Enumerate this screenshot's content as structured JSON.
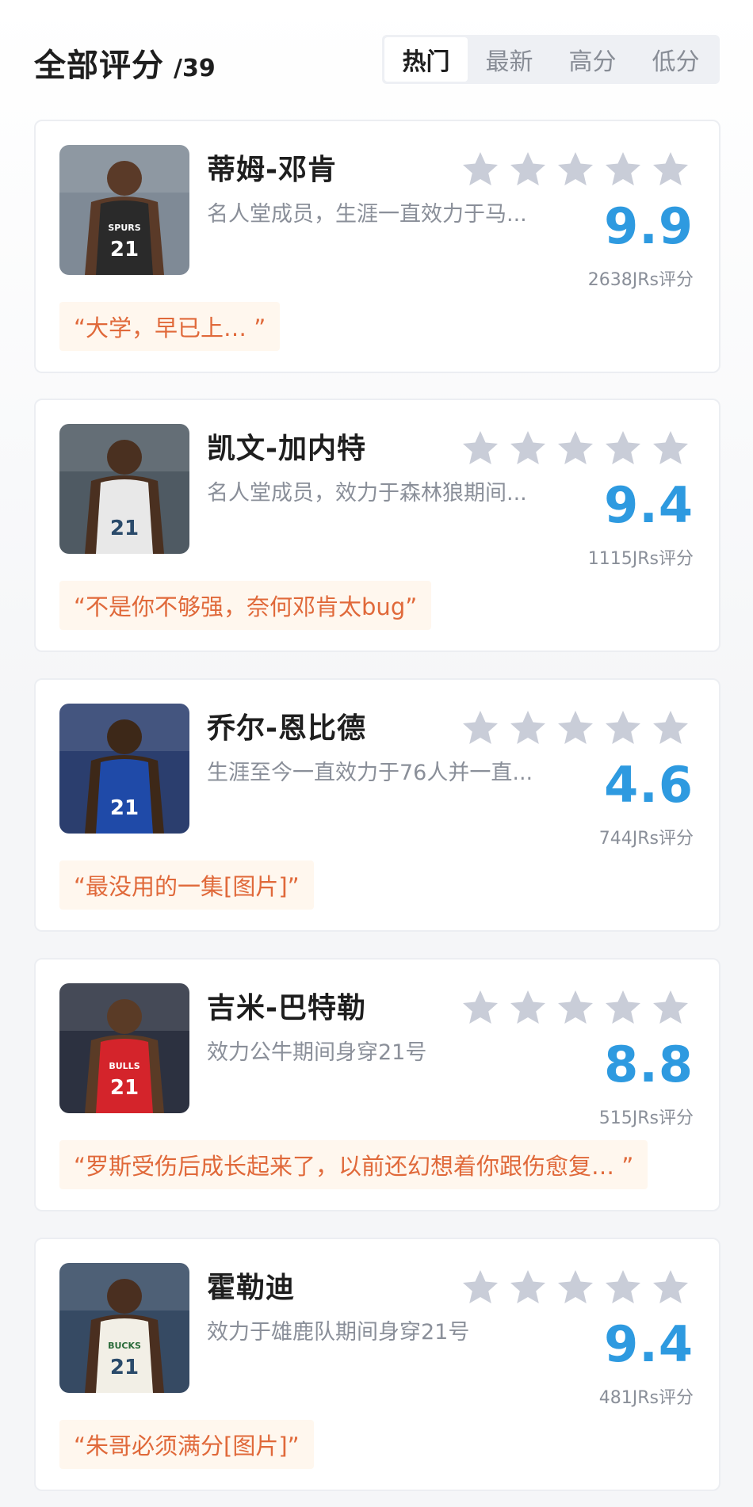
{
  "header": {
    "title": "全部评分",
    "count": "/39",
    "tabs": [
      "热门",
      "最新",
      "高分",
      "低分"
    ]
  },
  "colors": {
    "score": "#2e9ae0",
    "quote_text": "#e0693a",
    "quote_bg": "#fff7ee",
    "star": "#c9cdd8"
  },
  "players": [
    {
      "name": "蒂姆-邓肯",
      "desc": "名人堂成员，生涯一直效力于马...",
      "score": "9.9",
      "count": "2638JRs评分",
      "quote": "“大学，早已上… ”",
      "jersey_color": "#2a2a2a",
      "jersey_number": "21",
      "team_text": "SPURS"
    },
    {
      "name": "凯文-加内特",
      "desc": "名人堂成员，效力于森林狼期间...",
      "score": "9.4",
      "count": "1115JRs评分",
      "quote": "“不是你不够强，奈何邓肯太bug”",
      "jersey_color": "#e8e8e8",
      "jersey_number": "21",
      "team_text": ""
    },
    {
      "name": "乔尔-恩比德",
      "desc": "生涯至今一直效力于76人并一直...",
      "score": "4.6",
      "count": "744JRs评分",
      "quote": "“最没用的一集[图片]”",
      "jersey_color": "#1f4aa8",
      "jersey_number": "21",
      "team_text": ""
    },
    {
      "name": "吉米-巴特勒",
      "desc": "效力公牛期间身穿21号",
      "score": "8.8",
      "count": "515JRs评分",
      "quote": "“罗斯受伤后成长起来了，以前还幻想着你跟伤愈复… ”",
      "jersey_color": "#d4242b",
      "jersey_number": "21",
      "team_text": "BULLS"
    },
    {
      "name": "霍勒迪",
      "desc": "效力于雄鹿队期间身穿21号",
      "score": "9.4",
      "count": "481JRs评分",
      "quote": "“朱哥必须满分[图片]”",
      "jersey_color": "#f2efe6",
      "jersey_number": "21",
      "team_text": "BUCKS"
    }
  ]
}
